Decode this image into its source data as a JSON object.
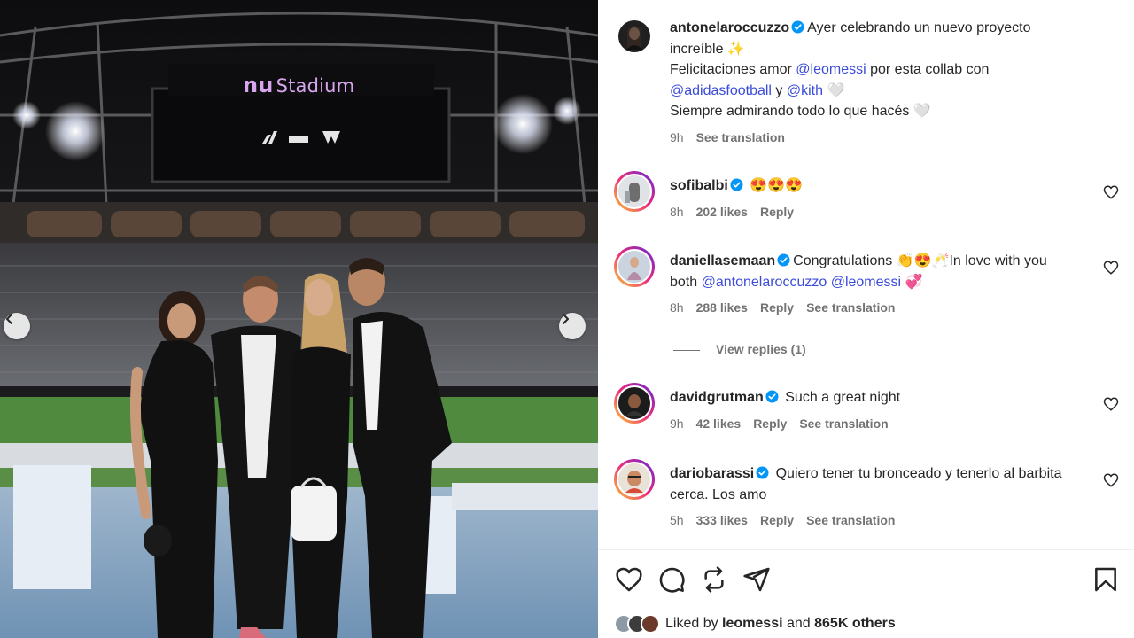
{
  "photo": {
    "screen_label_brand": "nu",
    "screen_label_text": "Stadium"
  },
  "caption": {
    "username": "antonelaroccuzzo",
    "line1": "Ayer celebrando un nuevo proyecto increíble ✨",
    "line2_pre": "Felicitaciones amor ",
    "line2_mention": "@leomessi",
    "line2_post": " por esta collab con",
    "line3_mention1": "@adidasfootball",
    "line3_mid": " y ",
    "line3_mention2": "@kith",
    "line3_post": " 🤍",
    "line4": "Siempre admirando todo lo que hacés 🤍",
    "time": "9h",
    "see_translation": "See translation"
  },
  "comments": [
    {
      "username": "sofibalbi",
      "text": "😍😍😍",
      "time": "8h",
      "likes": "202 likes",
      "reply": "Reply"
    },
    {
      "username": "daniellasemaan",
      "text_pre": "Congratulations 👏😍🥂In love with you both ",
      "mention1": "@antonelaroccuzzo",
      "mention2": "@leomessi",
      "text_post": " 💞",
      "time": "8h",
      "likes": "288 likes",
      "reply": "Reply",
      "see_translation": "See translation"
    },
    {
      "username": "davidgrutman",
      "text": "Such a great night",
      "time": "9h",
      "likes": "42 likes",
      "reply": "Reply",
      "see_translation": "See translation"
    },
    {
      "username": "dariobarassi",
      "text": "Quiero tener tu bronceado y tenerlo al barbita cerca. Los amo",
      "time": "5h",
      "likes": "333 likes",
      "reply": "Reply",
      "see_translation": "See translation"
    }
  ],
  "view_replies": "View replies (1)",
  "likes_summary": {
    "prefix": "Liked by ",
    "user": "leomessi",
    "middle": " and ",
    "count": "865K others"
  },
  "colors": {
    "mention": "#3b4cd9",
    "verified": "#0095f6",
    "muted": "#737373"
  },
  "icons": [
    "heart-icon",
    "comment-icon",
    "repost-icon",
    "share-icon",
    "bookmark-icon",
    "verified-icon",
    "chevron-left-icon",
    "chevron-right-icon"
  ]
}
